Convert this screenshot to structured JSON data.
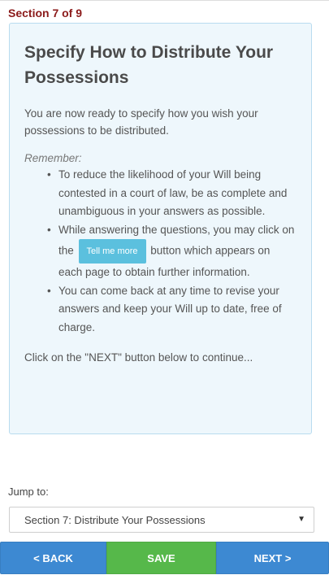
{
  "header": {
    "section_label": "Section 7 of 9"
  },
  "card": {
    "title": "Specify How to Distribute Your Possessions",
    "intro": "You are now ready to specify how you wish your possessions to be distributed.",
    "remember_label": "Remember:",
    "bullets": [
      "To reduce the likelihood of your Will being contested in a court of law, be as complete and unambiguous in your answers as possible.",
      {
        "before": "While answering the questions, you may click on the",
        "button_label": "Tell me more",
        "after": "button which appears on each page to obtain further information."
      },
      "You can come back at any time to revise your answers and keep your Will up to date, free of charge."
    ],
    "continue_text": "Click on the \"NEXT\" button below to continue..."
  },
  "jump": {
    "label": "Jump to:",
    "selected": "Section 7: Distribute Your Possessions"
  },
  "nav": {
    "back_label": "< BACK",
    "save_label": "SAVE",
    "next_label": "NEXT >"
  },
  "colors": {
    "section_label": "#8b1a1a",
    "card_background": "#eef7fc",
    "card_border": "#b9dcef",
    "tell_me_more_button": "#5bc0de",
    "back_next_button": "#3d89d2",
    "save_button": "#56b84a"
  },
  "icons": {
    "dropdown_caret": "caret-down-icon"
  }
}
